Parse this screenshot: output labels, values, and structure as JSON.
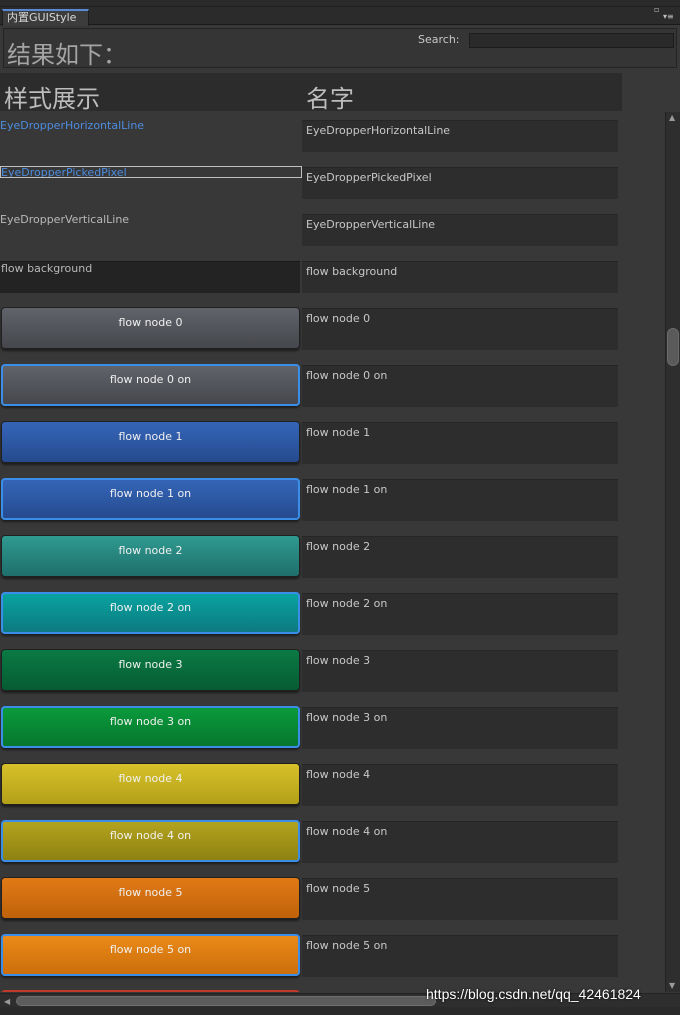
{
  "tab": {
    "title": "内置GUIStyle"
  },
  "header": {
    "title": "结果如下：",
    "search_label": "Search:",
    "search_value": ""
  },
  "columns": {
    "style": "样式展示",
    "name": "名字"
  },
  "rows": [
    {
      "name": "EyeDropperHorizontalLine",
      "label": "EyeDropperHorizontalLine"
    },
    {
      "name": "EyeDropperPickedPixel",
      "label": "EyeDropperPickedPixel"
    },
    {
      "name": "EyeDropperVerticalLine",
      "label": "EyeDropperVerticalLine"
    },
    {
      "name": "flow background",
      "label": "flow background"
    },
    {
      "name": "flow node 0",
      "label": "flow node 0",
      "top": "#60636a",
      "bottom": "#45474c"
    },
    {
      "name": "flow node 0 on",
      "label": "flow node 0 on",
      "top": "#60636a",
      "bottom": "#45474c"
    },
    {
      "name": "flow node 1",
      "label": "flow node 1",
      "top": "#3565b8",
      "bottom": "#254b8e"
    },
    {
      "name": "flow node 1 on",
      "label": "flow node 1 on",
      "top": "#3565b8",
      "bottom": "#254b8e"
    },
    {
      "name": "flow node 2",
      "label": "flow node 2",
      "top": "#2f9a90",
      "bottom": "#1f6f6c"
    },
    {
      "name": "flow node 2 on",
      "label": "flow node 2 on",
      "top": "#08a3a0",
      "bottom": "#0d7a80"
    },
    {
      "name": "flow node 3",
      "label": "flow node 3",
      "top": "#0a7a44",
      "bottom": "#075c33"
    },
    {
      "name": "flow node 3 on",
      "label": "flow node 3 on",
      "top": "#0a9a3c",
      "bottom": "#07772e"
    },
    {
      "name": "flow node 4",
      "label": "flow node 4",
      "top": "#d6c12a",
      "bottom": "#b4a018"
    },
    {
      "name": "flow node 4 on",
      "label": "flow node 4 on",
      "top": "#b3a31e",
      "bottom": "#8e8212"
    },
    {
      "name": "flow node 5",
      "label": "flow node 5",
      "top": "#e07a16",
      "bottom": "#c0620a"
    },
    {
      "name": "flow node 5 on",
      "label": "flow node 5 on",
      "top": "#ea8a18",
      "bottom": "#cc6e0c"
    }
  ],
  "watermark": "https://blog.csdn.net/qq_42461824"
}
